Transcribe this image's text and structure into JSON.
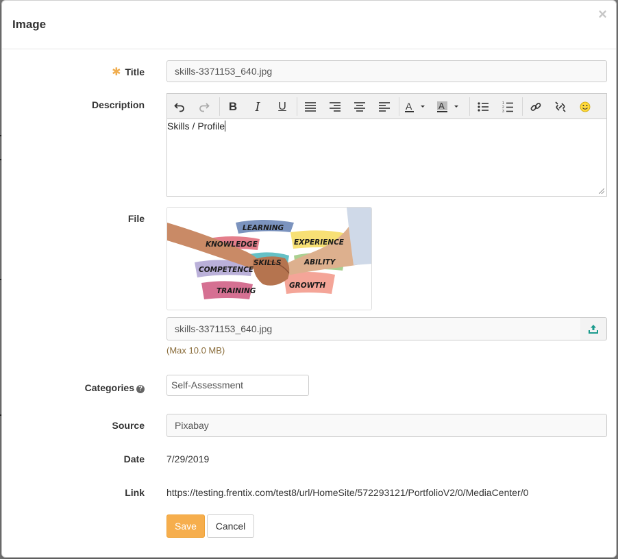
{
  "dialog": {
    "title": "Image",
    "close_icon": "×"
  },
  "form": {
    "title": {
      "label": "Title",
      "required_icon": "✱",
      "value": "skills-3371153_640.jpg"
    },
    "description": {
      "label": "Description",
      "content": "Skills / Profile",
      "toolbar": [
        "undo-icon",
        "redo-icon",
        "bold-icon",
        "italic-icon",
        "underline-icon",
        "align-justify-icon",
        "align-right-icon",
        "align-center-icon",
        "align-left-icon",
        "text-color-icon",
        "background-color-icon",
        "bullet-list-icon",
        "numbered-list-icon",
        "link-icon",
        "unlink-icon",
        "emoticon-icon"
      ]
    },
    "file": {
      "label": "File",
      "image_words": [
        "LEARNING",
        "KNOWLEDGE",
        "EXPERIENCE",
        "SKILLS",
        "ABILITY",
        "COMPETENCE",
        "GROWTH",
        "TRAINING"
      ],
      "filename": "skills-3371153_640.jpg",
      "max_hint": "(Max 10.0 MB)"
    },
    "categories": {
      "label": "Categories",
      "help_icon": "?",
      "value": "Self-Assessment"
    },
    "source": {
      "label": "Source",
      "value": "Pixabay"
    },
    "date": {
      "label": "Date",
      "value": "7/29/2019"
    },
    "link": {
      "label": "Link",
      "value": "https://testing.frentix.com/test8/url/HomeSite/572293121/PortfolioV2/0/MediaCenter/0"
    }
  },
  "actions": {
    "save": "Save",
    "cancel": "Cancel"
  },
  "colors": {
    "primary": "#f6ae4d",
    "required": "#f0ad4e",
    "hint": "#8a6d3b",
    "upload_icon": "#1a9a8c"
  }
}
